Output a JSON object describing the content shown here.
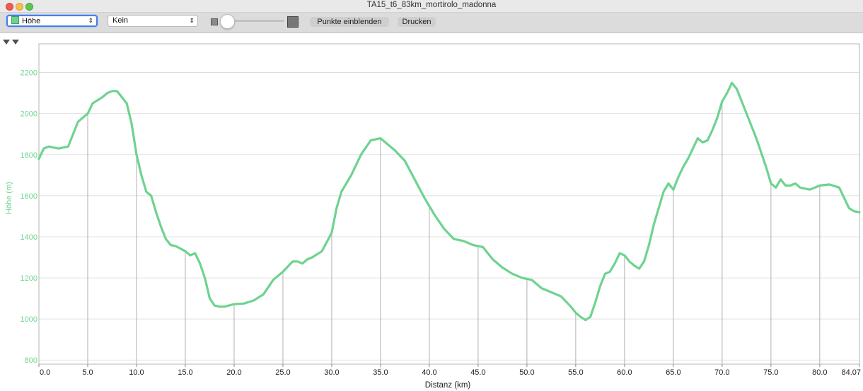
{
  "window": {
    "title": "TA15_t6_83km_mortirolo_madonna"
  },
  "toolbar": {
    "series_select": "Höhe",
    "overlay_select": "Kein",
    "show_points_label": "Punkte einblenden",
    "print_label": "Drucken",
    "zoom_level": 0.08
  },
  "colors": {
    "series": "#6ed38f",
    "axis_label": "#6ed38f",
    "grid": "#d4d4d4",
    "vline": "#b0b0b0"
  },
  "chart_data": {
    "type": "line",
    "xlabel": "Distanz (km)",
    "ylabel": "Höhe (m)",
    "xlim": [
      0,
      84.07
    ],
    "ylim": [
      780,
      2340
    ],
    "x_ticks": [
      "0.0",
      "5.0",
      "10.0",
      "15.0",
      "20.0",
      "25.0",
      "30.0",
      "35.0",
      "40.0",
      "45.0",
      "50.0",
      "55.0",
      "60.0",
      "65.0",
      "70.0",
      "75.0",
      "80.0",
      "84.07"
    ],
    "y_ticks": [
      "800",
      "1000",
      "1200",
      "1400",
      "1600",
      "1800",
      "2000",
      "2200"
    ],
    "series": [
      {
        "x": [
          0.0,
          0.5,
          1.0,
          2.0,
          3.0,
          3.5,
          4.0,
          4.5,
          5.0,
          5.5,
          6.5,
          7.0,
          7.5,
          8.0,
          8.5,
          9.0,
          9.5,
          10.0,
          10.5,
          11.0,
          11.5,
          12.0,
          12.5,
          13.0,
          13.5,
          14.0,
          15.0,
          15.5,
          16.0,
          16.5,
          17.0,
          17.5,
          18.0,
          18.5,
          19.0,
          20.0,
          21.0,
          22.0,
          23.0,
          24.0,
          25.0,
          26.0,
          26.5,
          27.0,
          27.5,
          28.0,
          29.0,
          30.0,
          30.5,
          31.0,
          32.0,
          33.0,
          34.0,
          35.0,
          35.5,
          36.5,
          37.5,
          38.5,
          39.5,
          40.5,
          41.5,
          42.5,
          43.5,
          44.5,
          45.5,
          46.5,
          47.5,
          48.5,
          49.5,
          50.5,
          51.5,
          52.5,
          53.5,
          54.5,
          55.0,
          55.5,
          56.0,
          56.5,
          57.0,
          57.5,
          58.0,
          58.5,
          59.0,
          59.5,
          60.0,
          60.5,
          61.0,
          61.5,
          62.0,
          62.5,
          63.0,
          63.5,
          64.0,
          64.5,
          65.0,
          65.5,
          66.0,
          66.5,
          67.0,
          67.5,
          68.0,
          68.5,
          69.0,
          69.5,
          70.0,
          70.5,
          71.0,
          71.5,
          72.0,
          72.5,
          73.0,
          73.5,
          74.0,
          74.5,
          75.0,
          75.5,
          76.0,
          76.5,
          77.0,
          77.5,
          78.0,
          79.0,
          80.0,
          81.0,
          82.0,
          83.0,
          83.5,
          84.07
        ],
        "y": [
          1780,
          1830,
          1840,
          1830,
          1840,
          1900,
          1960,
          1980,
          2000,
          2050,
          2080,
          2100,
          2110,
          2110,
          2080,
          2050,
          1950,
          1800,
          1700,
          1620,
          1600,
          1520,
          1450,
          1390,
          1360,
          1355,
          1330,
          1310,
          1320,
          1270,
          1200,
          1100,
          1065,
          1060,
          1060,
          1072,
          1075,
          1090,
          1120,
          1190,
          1230,
          1280,
          1280,
          1270,
          1290,
          1300,
          1330,
          1420,
          1540,
          1620,
          1700,
          1800,
          1870,
          1880,
          1860,
          1820,
          1770,
          1680,
          1590,
          1510,
          1440,
          1390,
          1380,
          1360,
          1350,
          1290,
          1250,
          1220,
          1200,
          1190,
          1150,
          1130,
          1110,
          1060,
          1030,
          1010,
          995,
          1010,
          1080,
          1160,
          1220,
          1230,
          1270,
          1320,
          1310,
          1280,
          1260,
          1245,
          1280,
          1360,
          1460,
          1540,
          1620,
          1660,
          1630,
          1690,
          1740,
          1780,
          1830,
          1880,
          1860,
          1870,
          1920,
          1980,
          2060,
          2100,
          2150,
          2120,
          2060,
          2000,
          1940,
          1880,
          1810,
          1740,
          1660,
          1640,
          1680,
          1650,
          1650,
          1660,
          1640,
          1630,
          1650,
          1655,
          1640,
          1540,
          1525,
          1520
        ]
      }
    ]
  }
}
